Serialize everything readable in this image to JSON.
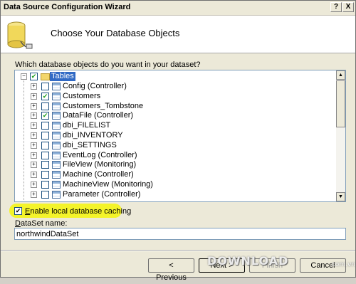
{
  "window": {
    "title": "Data Source Configuration Wizard",
    "help_glyph": "?",
    "close_glyph": "X"
  },
  "header": {
    "title": "Choose Your Database Objects",
    "icon": "database-icon"
  },
  "tree": {
    "prompt": "Which database objects do you want in your dataset?",
    "root": {
      "label": "Tables",
      "expanded": true,
      "state": "partial"
    },
    "items": [
      {
        "label": "Config (Controller)",
        "checked": false
      },
      {
        "label": "Customers",
        "checked": true
      },
      {
        "label": "Customers_Tombstone",
        "checked": false
      },
      {
        "label": "DataFile (Controller)",
        "checked": true
      },
      {
        "label": "dbi_FILELIST",
        "checked": false
      },
      {
        "label": "dbi_INVENTORY",
        "checked": false
      },
      {
        "label": "dbi_SETTINGS",
        "checked": false
      },
      {
        "label": "EventLog (Controller)",
        "checked": false
      },
      {
        "label": "FileView (Monitoring)",
        "checked": false
      },
      {
        "label": "Machine (Controller)",
        "checked": false
      },
      {
        "label": "MachineView (Monitoring)",
        "checked": false
      },
      {
        "label": "Parameter (Controller)",
        "checked": false
      }
    ]
  },
  "options": {
    "enable_caching_label": "Enable local database caching",
    "enable_caching_checked": true
  },
  "dataset": {
    "label": "DataSet name:",
    "value": "northwindDataSet"
  },
  "buttons": {
    "previous": "< Previous",
    "next": "Next >",
    "finish": "Finish",
    "cancel": "Cancel"
  },
  "watermark": {
    "text": "DOWNLOAD",
    "suffix": ".com.vn"
  },
  "colors": {
    "highlight": "#f4f42a",
    "selection": "#316ac5",
    "check": "#21a121"
  }
}
